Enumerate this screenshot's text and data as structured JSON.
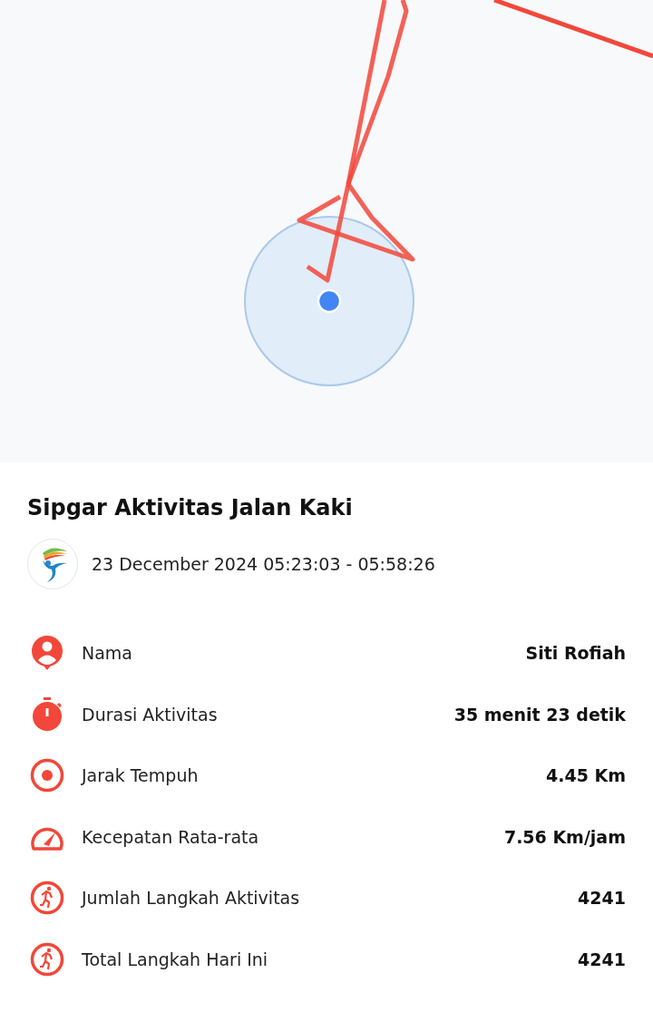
{
  "map": {
    "kind": "route"
  },
  "title": "Sipgar Aktivitas Jalan Kaki",
  "datetime": "23 December 2024 05:23:03 - 05:58:26",
  "stats": [
    {
      "kind": "person",
      "label": "Nama",
      "value": "Siti Rofiah"
    },
    {
      "kind": "timer",
      "label": "Durasi Aktivitas",
      "value": "35 menit 23 detik"
    },
    {
      "kind": "target",
      "label": "Jarak Tempuh",
      "value": "4.45 Km"
    },
    {
      "kind": "speed",
      "label": "Kecepatan Rata-rata",
      "value": "7.56 Km/jam"
    },
    {
      "kind": "runner",
      "label": "Jumlah Langkah Aktivitas",
      "value": "4241"
    },
    {
      "kind": "runner",
      "label": "Total Langkah Hari Ini",
      "value": "4241"
    }
  ]
}
